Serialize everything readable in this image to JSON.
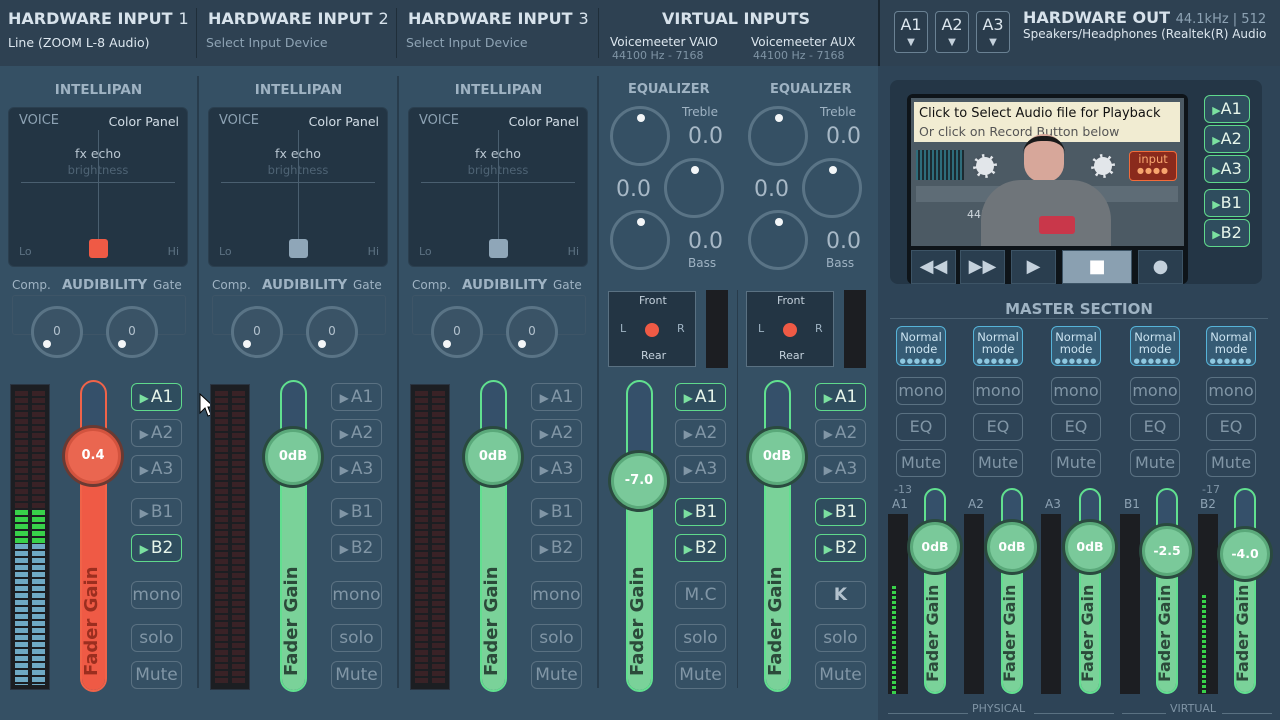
{
  "header": {
    "hw1": {
      "title": "HARDWARE INPUT",
      "num": "1",
      "device": "Line (ZOOM L-8 Audio)"
    },
    "hw2": {
      "title": "HARDWARE INPUT",
      "num": "2",
      "device": "Select Input Device"
    },
    "hw3": {
      "title": "HARDWARE INPUT",
      "num": "3",
      "device": "Select Input Device"
    },
    "virtual": {
      "title": "VIRTUAL INPUTS",
      "vaio": "Voicemeeter VAIO",
      "vaio_freq": "44100 Hz - 7168",
      "aux": "Voicemeeter AUX",
      "aux_freq": "44100 Hz - 7168"
    },
    "abuttons": [
      "A1",
      "A2",
      "A3"
    ],
    "hwout": {
      "title": "HARDWARE OUT",
      "spec": "44.1kHz | 512",
      "device": "Speakers/Headphones (Realtek(R) Audio"
    }
  },
  "strips": [
    {
      "section": "INTELLIPAN",
      "voice": "VOICE",
      "color_panel": "Color Panel",
      "fx": "fx echo",
      "brightness": "brightness",
      "lo": "Lo",
      "hi": "Hi",
      "comp": "Comp.",
      "audibility": "AUDIBILITY",
      "gate": "Gate",
      "comp_val": "0",
      "gate_val": "0",
      "gain": "0.4",
      "gain_db": 0.4,
      "fader_label": "Fader Gain",
      "buses": [
        "A1",
        "A2",
        "A3",
        "B1",
        "B2"
      ],
      "mono": "mono",
      "solo": "solo",
      "mute": "Mute",
      "state": "A1,B2 on",
      "level": 0.55
    },
    {
      "section": "INTELLIPAN",
      "voice": "VOICE",
      "color_panel": "Color Panel",
      "fx": "fx echo",
      "brightness": "brightness",
      "lo": "Lo",
      "hi": "Hi",
      "comp": "Comp.",
      "audibility": "AUDIBILITY",
      "gate": "Gate",
      "comp_val": "0",
      "gate_val": "0",
      "gain": "0dB",
      "gain_db": 0,
      "fader_label": "Fader Gain",
      "buses": [
        "A1",
        "A2",
        "A3",
        "B1",
        "B2"
      ],
      "mono": "mono",
      "solo": "solo",
      "mute": "Mute"
    },
    {
      "section": "INTELLIPAN",
      "voice": "VOICE",
      "color_panel": "Color Panel",
      "fx": "fx echo",
      "brightness": "brightness",
      "lo": "Lo",
      "hi": "Hi",
      "comp": "Comp.",
      "audibility": "AUDIBILITY",
      "gate": "Gate",
      "comp_val": "0",
      "gate_val": "0",
      "gain": "0dB",
      "gain_db": 0,
      "fader_label": "Fader Gain",
      "buses": [
        "A1",
        "A2",
        "A3",
        "B1",
        "B2"
      ],
      "mono": "mono",
      "solo": "solo",
      "mute": "Mute"
    }
  ],
  "virtual_strips": [
    {
      "section": "EQUALIZER",
      "treble": "Treble",
      "treble_val": "0.0",
      "mid_val": "0.0",
      "bass_val": "0.0",
      "bass": "Bass",
      "front": "Front",
      "rear": "Rear",
      "l": "L",
      "r": "R",
      "gain": "-7.0",
      "gain_db": -7.0,
      "fader_label": "Fader Gain",
      "buses": [
        "A1",
        "A2",
        "A3",
        "B1",
        "B2"
      ],
      "mc": "M.C",
      "solo": "solo",
      "mute": "Mute"
    },
    {
      "section": "EQUALIZER",
      "treble": "Treble",
      "treble_val": "0.0",
      "mid_val": "0.0",
      "bass_val": "0.0",
      "bass": "Bass",
      "front": "Front",
      "rear": "Rear",
      "l": "L",
      "r": "R",
      "gain": "0dB",
      "gain_db": 0,
      "fader_label": "Fader Gain",
      "buses": [
        "A1",
        "A2",
        "A3",
        "B1",
        "B2"
      ],
      "mc": "K",
      "solo": "solo",
      "mute": "Mute"
    }
  ],
  "player": {
    "line1": "Click to Select Audio file for Playback",
    "line2": "Or click on Record Button below",
    "input_label": "input",
    "rate": "4410"
  },
  "player_buses": [
    "A1",
    "A2",
    "A3",
    "B1",
    "B2"
  ],
  "master": {
    "title": "MASTER SECTION",
    "buses": [
      {
        "name": "A1",
        "mode": "Normal mode",
        "mono": "mono",
        "eq": "EQ",
        "mute": "Mute",
        "gain": "0dB",
        "gain_db": 0,
        "peak": "-13",
        "fader_label": "Fader Gain"
      },
      {
        "name": "A2",
        "mode": "Normal mode",
        "mono": "mono",
        "eq": "EQ",
        "mute": "Mute",
        "gain": "0dB",
        "gain_db": 0,
        "peak": "",
        "fader_label": "Fader Gain"
      },
      {
        "name": "A3",
        "mode": "Normal mode",
        "mono": "mono",
        "eq": "EQ",
        "mute": "Mute",
        "gain": "0dB",
        "gain_db": 0,
        "peak": "",
        "fader_label": "Fader Gain"
      },
      {
        "name": "B1",
        "mode": "Normal mode",
        "mono": "mono",
        "eq": "EQ",
        "mute": "Mute",
        "gain": "-2.5",
        "gain_db": -2.5,
        "peak": "",
        "fader_label": "Fader Gain"
      },
      {
        "name": "B2",
        "mode": "Normal mode",
        "mono": "mono",
        "eq": "EQ",
        "mute": "Mute",
        "gain": "-4.0",
        "gain_db": -4.0,
        "peak": "-17",
        "fader_label": "Fader Gain"
      }
    ],
    "physical": "PHYSICAL",
    "virtual": "VIRTUAL"
  },
  "colors": {
    "active_green": "#5fd98c",
    "fader_red": "#ef5a45",
    "meter_green": "#38d14a",
    "meter_blue": "#6fa9c4"
  }
}
